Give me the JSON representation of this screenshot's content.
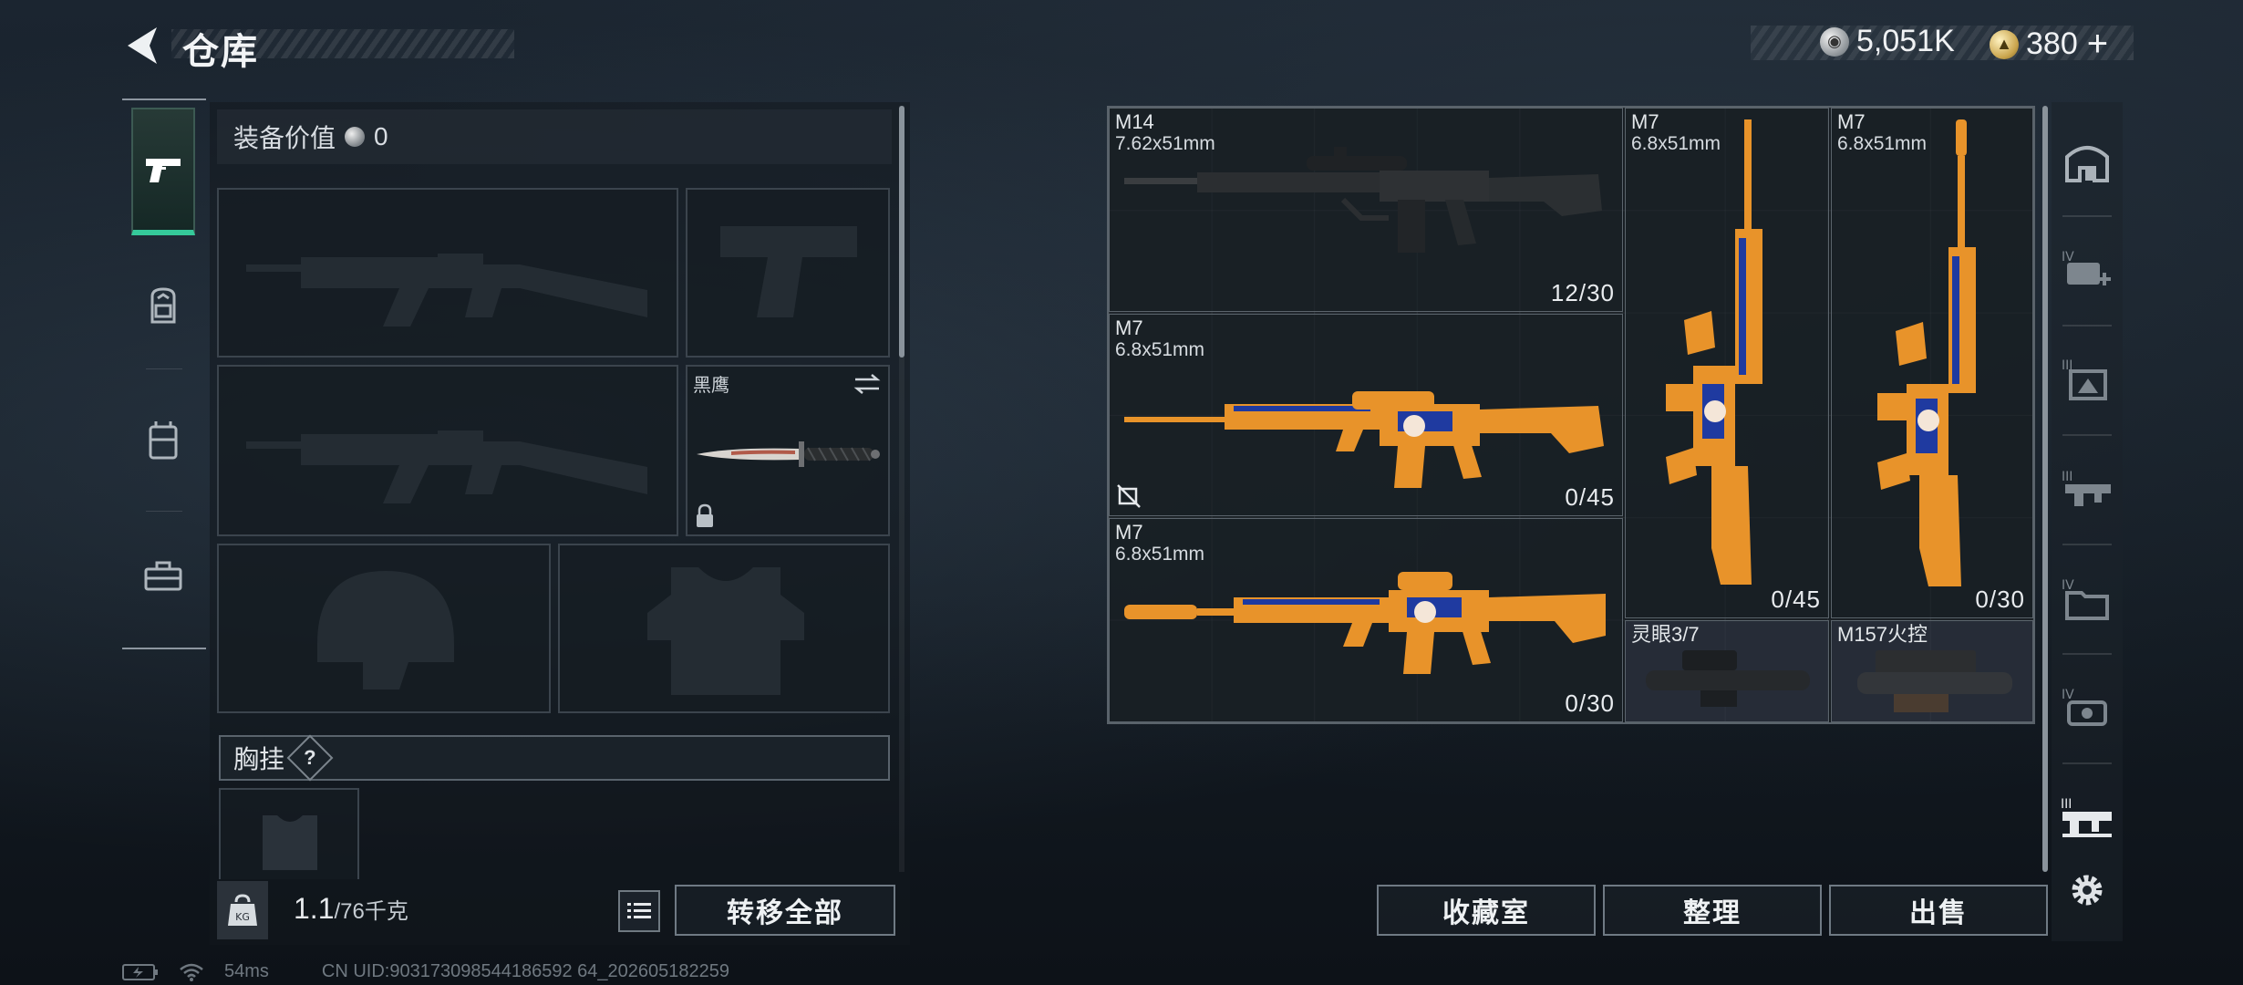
{
  "header": {
    "title": "仓库",
    "currency_silver": "5,051K",
    "currency_gold": "380",
    "currency_gold_plus": "+"
  },
  "left_tabs": [
    "weapons-tab",
    "backpack-tab",
    "rig-tab",
    "toolbox-tab"
  ],
  "equipment": {
    "value_label": "装备价值",
    "value": "0",
    "melee_label": "黑鹰",
    "chest_rig_label": "胸挂",
    "help": "?"
  },
  "bottom_left": {
    "weight_current": "1.1",
    "weight_max": "/76千克",
    "transfer_all": "转移全部"
  },
  "warehouse": {
    "items": [
      {
        "name": "M14",
        "caliber": "7.62x51mm",
        "ammo": "12/30"
      },
      {
        "name": "M7",
        "caliber": "6.8x51mm",
        "ammo": "0/45"
      },
      {
        "name": "M7",
        "caliber": "6.8x51mm",
        "ammo": "0/30"
      },
      {
        "name": "M7",
        "caliber": "6.8x51mm",
        "ammo": "0/45"
      },
      {
        "name": "M7",
        "caliber": "6.8x51mm",
        "ammo": "0/30"
      },
      {
        "name": "灵眼3/7",
        "caliber": "",
        "ammo": ""
      },
      {
        "name": "M157火控",
        "caliber": "",
        "ammo": ""
      }
    ]
  },
  "actions": {
    "collection": "收藏室",
    "sort": "整理",
    "sell": "出售"
  },
  "right_rail": [
    "storage-icon",
    "medkit-IV-icon",
    "armor-III-icon",
    "rifle-III-icon",
    "folder-IV-icon",
    "gear-IV-icon",
    "weapon-rack-III-icon",
    "settings-icon"
  ],
  "footer": {
    "ping": "54ms",
    "uid": "CN UID:903173098544186592 64_202605182259"
  },
  "colors": {
    "accent_green": "#35c99a",
    "weapon_orange": "#e8932a",
    "weapon_blue": "#1f3aa0"
  }
}
